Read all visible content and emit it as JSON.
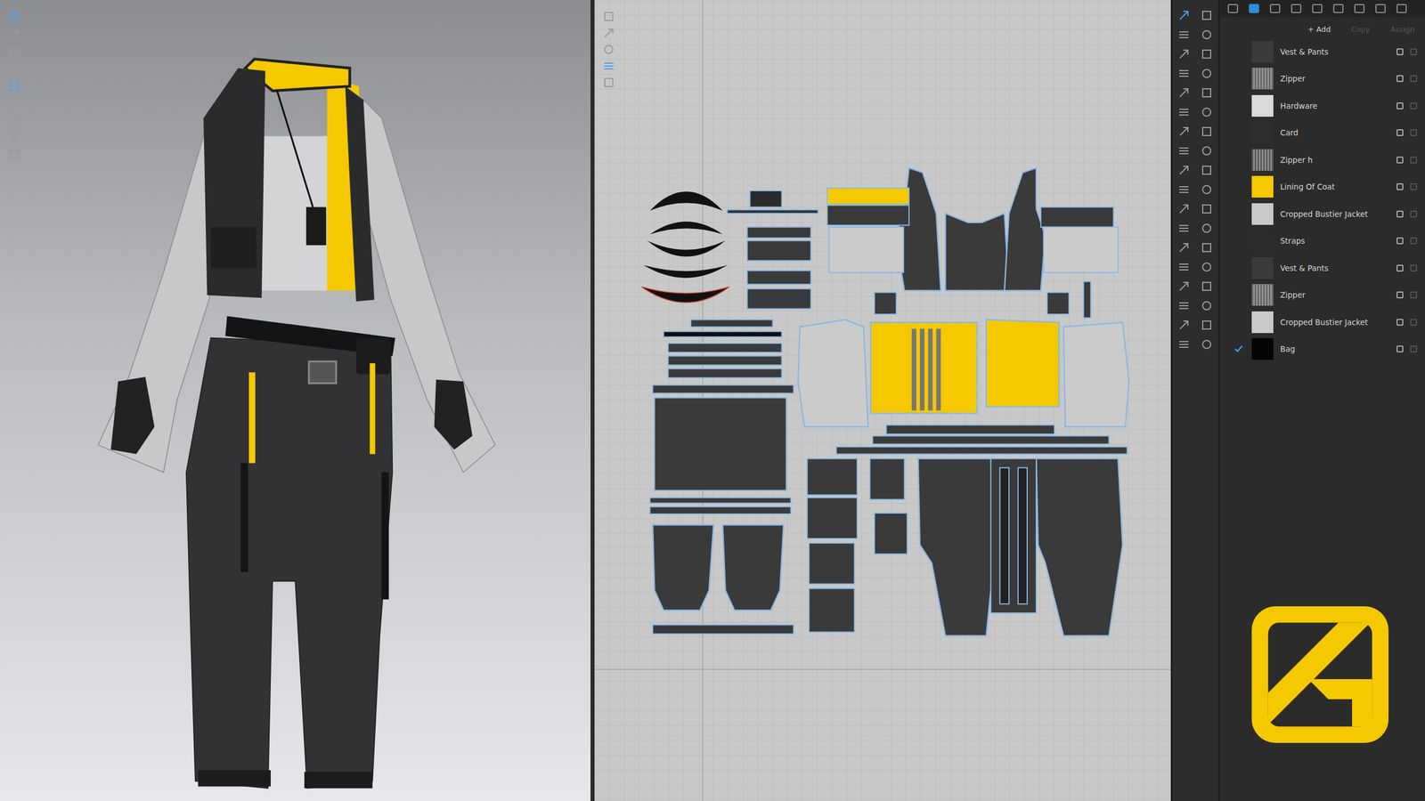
{
  "object_browser": {
    "actions": [
      {
        "label": "+ Add",
        "disabled": false
      },
      {
        "label": "Copy",
        "disabled": true
      },
      {
        "label": "Assign",
        "disabled": true
      }
    ],
    "items": [
      {
        "name": "Vest & Pants",
        "kind": "solid",
        "color": "#3b3b3b",
        "selected": false
      },
      {
        "name": "Zipper",
        "kind": "texture",
        "color": "#6a6a6a",
        "selected": false
      },
      {
        "name": "Hardware",
        "kind": "solid",
        "color": "#d9d9d9",
        "selected": false
      },
      {
        "name": "Card",
        "kind": "solid",
        "color": "#2e2e2e",
        "selected": false
      },
      {
        "name": "Zipper h",
        "kind": "texture",
        "color": "#5a5a5a",
        "selected": false
      },
      {
        "name": "Lining Of Coat",
        "kind": "solid",
        "color": "#f5c800",
        "selected": false
      },
      {
        "name": "Cropped Bustier Jacket",
        "kind": "solid",
        "color": "#c9c9c9",
        "selected": false
      },
      {
        "name": "Straps",
        "kind": "solid",
        "color": "#2c2c2c",
        "selected": false
      },
      {
        "name": "Vest & Pants",
        "kind": "solid",
        "color": "#3b3b3b",
        "selected": false
      },
      {
        "name": "Zipper",
        "kind": "texture",
        "color": "#6a6a6a",
        "selected": false
      },
      {
        "name": "Cropped Bustier Jacket",
        "kind": "solid",
        "color": "#c9c9c9",
        "selected": false
      },
      {
        "name": "Bag",
        "kind": "solid",
        "color": "#050505",
        "selected": true
      }
    ]
  }
}
